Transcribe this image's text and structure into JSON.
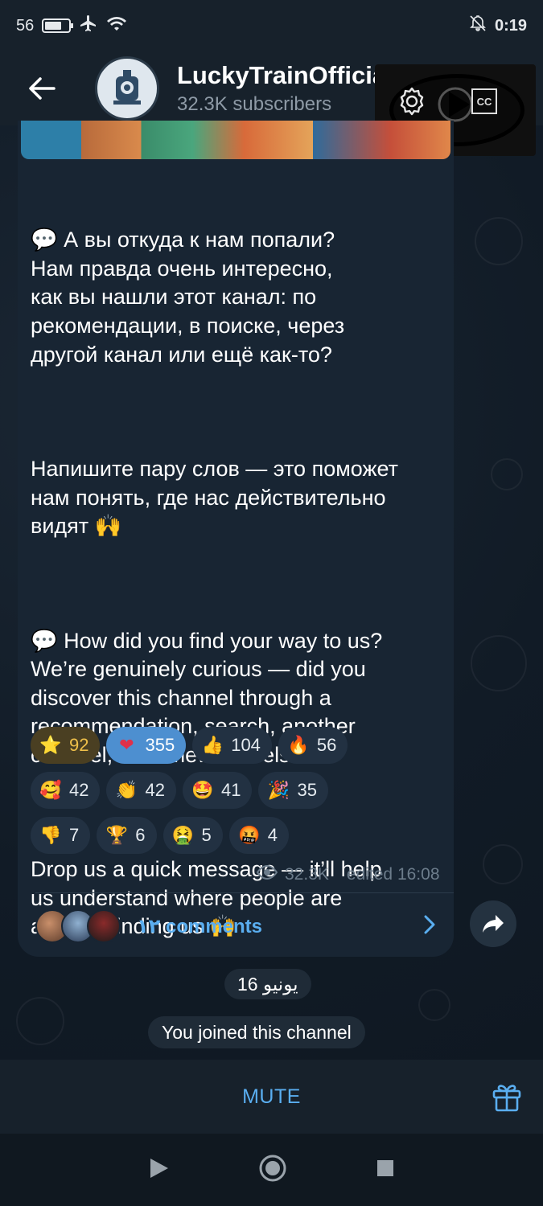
{
  "status_bar": {
    "signal": "56",
    "time": "0:19"
  },
  "header": {
    "channel_name": "LuckyTrainOfficial",
    "subscribers": "32.3K subscribers"
  },
  "pip": {
    "cc_label": "CC"
  },
  "message": {
    "paragraphs": [
      "💬 А вы откуда к нам попали?\nНам правда очень интересно,\nкак вы нашли этот канал: по\nрекомендации, в поиске, через\nдругой канал или ещё как-то?",
      "Напишите пару слов — это поможет\nнам понять, где нас действительно\nвидят 🙌",
      "💬 How did you find your way to us?\nWe’re genuinely curious — did you\ndiscover this channel through a\nrecommendation, search, another\nchannel, or somewhere else?",
      "Drop us a quick message — it’ll help\nus understand where people are\nactually finding us 🙌"
    ],
    "views": "32.3K",
    "edited": "edited 16:08"
  },
  "reactions": [
    [
      {
        "emoji": "⭐",
        "count": "92"
      },
      {
        "emoji": "❤",
        "count": "355"
      },
      {
        "emoji": "👍",
        "count": "104"
      },
      {
        "emoji": "🔥",
        "count": "56"
      }
    ],
    [
      {
        "emoji": "🥰",
        "count": "42"
      },
      {
        "emoji": "👏",
        "count": "42"
      },
      {
        "emoji": "🤩",
        "count": "41"
      },
      {
        "emoji": "🎉",
        "count": "35"
      }
    ],
    [
      {
        "emoji": "👎",
        "count": "7"
      },
      {
        "emoji": "🏆",
        "count": "6"
      },
      {
        "emoji": "🤮",
        "count": "5"
      },
      {
        "emoji": "🤬",
        "count": "4"
      }
    ]
  ],
  "comments": {
    "label": "١٢ comments"
  },
  "date_pill": "16 يونيو",
  "service_message": "You joined this channel",
  "bottom_bar": {
    "mute_label": "MUTE"
  },
  "colors": {
    "accent": "#5aaef0",
    "bubble": "#182533",
    "header": "#17212b"
  }
}
